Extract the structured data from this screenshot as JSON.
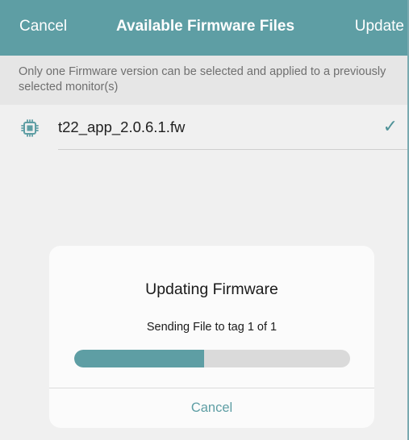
{
  "nav": {
    "cancel_label": "Cancel",
    "title": "Available Firmware Files",
    "update_label": "Update"
  },
  "notice": {
    "text": "Only one Firmware version can be selected and applied to a previously selected monitor(s)"
  },
  "files": [
    {
      "name": "t22_app_2.0.6.1.fw",
      "icon": "chip-icon",
      "selected": true
    }
  ],
  "dialog": {
    "title": "Updating Firmware",
    "message": "Sending File to tag 1 of 1",
    "progress": 0.47,
    "cancel_label": "Cancel"
  },
  "colors": {
    "accent": "#5e9ea4",
    "accent_dark": "#4f9298",
    "nav_bg": "#5e9ea4",
    "background": "#f0f0f0"
  }
}
